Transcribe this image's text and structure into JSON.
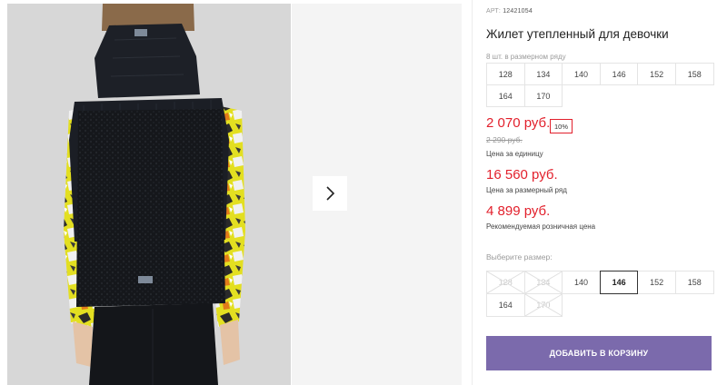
{
  "product": {
    "article_label": "АРТ:",
    "article_number": "12421054",
    "title": "Жилет утепленный для девочки",
    "pack_note": "8 шт. в размерном ряду",
    "pack_sizes": [
      "128",
      "134",
      "140",
      "146",
      "152",
      "158",
      "164",
      "170"
    ]
  },
  "pricing": {
    "unit_price": "2 070 руб.",
    "discount_badge": "10%",
    "old_price": "2 290 руб.",
    "unit_caption": "Цена за единицу",
    "pack_price": "16 560 руб.",
    "pack_caption": "Цена за размерный ряд",
    "rrp_price": "4 899 руб.",
    "rrp_caption": "Рекомендуемая розничная цена"
  },
  "size_selector": {
    "label": "Выберите размер:",
    "sizes": [
      {
        "label": "128",
        "state": "unavailable"
      },
      {
        "label": "134",
        "state": "unavailable"
      },
      {
        "label": "140",
        "state": "available"
      },
      {
        "label": "146",
        "state": "selected"
      },
      {
        "label": "152",
        "state": "available"
      },
      {
        "label": "158",
        "state": "available"
      },
      {
        "label": "164",
        "state": "available"
      },
      {
        "label": "170",
        "state": "unavailable"
      }
    ]
  },
  "actions": {
    "add_to_cart": "ДОБАВИТЬ В КОРЗИНУ"
  },
  "gallery": {
    "next_icon": "chevron-right-icon"
  },
  "colors": {
    "price_red": "#e2202c",
    "button_purple": "#7b6aac",
    "vest_black": "#1c1f26",
    "sleeve_yellow": "#e8e21c"
  }
}
